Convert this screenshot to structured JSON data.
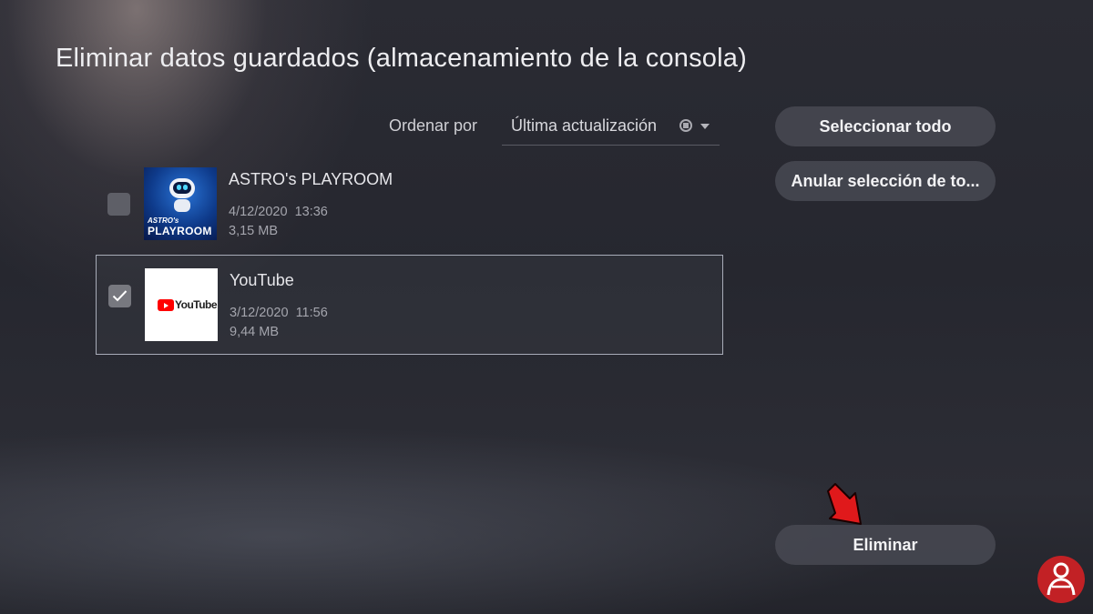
{
  "page": {
    "title": "Eliminar datos guardados (almacenamiento de la consola)"
  },
  "sort": {
    "label": "Ordenar por",
    "value": "Última actualización"
  },
  "actions": {
    "select_all": "Seleccionar todo",
    "deselect_all": "Anular selección de to...",
    "delete": "Eliminar"
  },
  "items": [
    {
      "name": "ASTRO's PLAYROOM",
      "date": "4/12/2020  13:36",
      "size": "3,15 MB",
      "checked": false,
      "thumb_text_small": "ASTRO's",
      "thumb_text_big": "PLAYROOM"
    },
    {
      "name": "YouTube",
      "date": "3/12/2020  11:56",
      "size": "9,44 MB",
      "checked": true,
      "thumb_text": "YouTube"
    }
  ],
  "colors": {
    "accent_arrow": "#e0191b",
    "background": "#2a2b33"
  },
  "icons": [
    "checkmark-icon",
    "options-button-icon",
    "chevron-down-icon",
    "arrow-pointer-icon",
    "watermark-logo"
  ]
}
